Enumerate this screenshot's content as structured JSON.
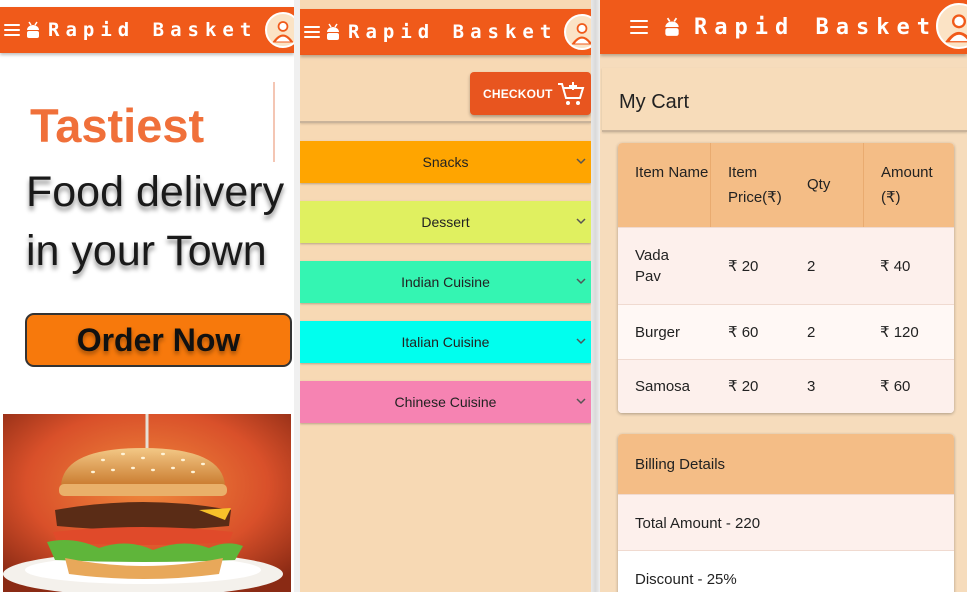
{
  "brand": "Rapid Basket",
  "icons": {
    "menu": "menu-icon",
    "logo": "android-bot-icon",
    "profile": "user-avatar-icon",
    "cart": "cart-add-icon",
    "expand": "chevron-down-icon"
  },
  "colors": {
    "app_bar": "#f05a1a",
    "hero_accent": "#f0703a",
    "order_button": "#f7790c",
    "checkout_button": "#e8551f",
    "table_header": "#f4bd86",
    "page_background": "#f7d9b4"
  },
  "home": {
    "headline": "Tastiest",
    "tagline_line1": "Food delivery",
    "tagline_line2": "in your Town",
    "order_button": "Order Now"
  },
  "menu_screen": {
    "checkout_label": "CHECKOUT",
    "categories": [
      {
        "label": "Snacks",
        "color": "#ffa500"
      },
      {
        "label": "Dessert",
        "color": "#e0f060"
      },
      {
        "label": "Indian Cuisine",
        "color": "#34f5b2"
      },
      {
        "label": "Italian Cuisine",
        "color": "#00ffee"
      },
      {
        "label": "Chinese Cuisine",
        "color": "#f683b2"
      }
    ]
  },
  "cart": {
    "title": "My Cart",
    "headers": {
      "item_name": "Item Name",
      "item_price": "Item Price(₹)",
      "qty": "Qty",
      "amount": "Amount (₹)"
    },
    "rows": [
      {
        "name": "Vada Pav",
        "price": "₹ 20",
        "qty": "2",
        "amount": "₹ 40"
      },
      {
        "name": "Burger",
        "price": "₹ 60",
        "qty": "2",
        "amount": "₹ 120"
      },
      {
        "name": "Samosa",
        "price": "₹ 20",
        "qty": "3",
        "amount": "₹ 60"
      }
    ],
    "billing": {
      "title": "Billing Details",
      "total": "Total Amount - 220",
      "discount": "Discount - 25%"
    }
  }
}
